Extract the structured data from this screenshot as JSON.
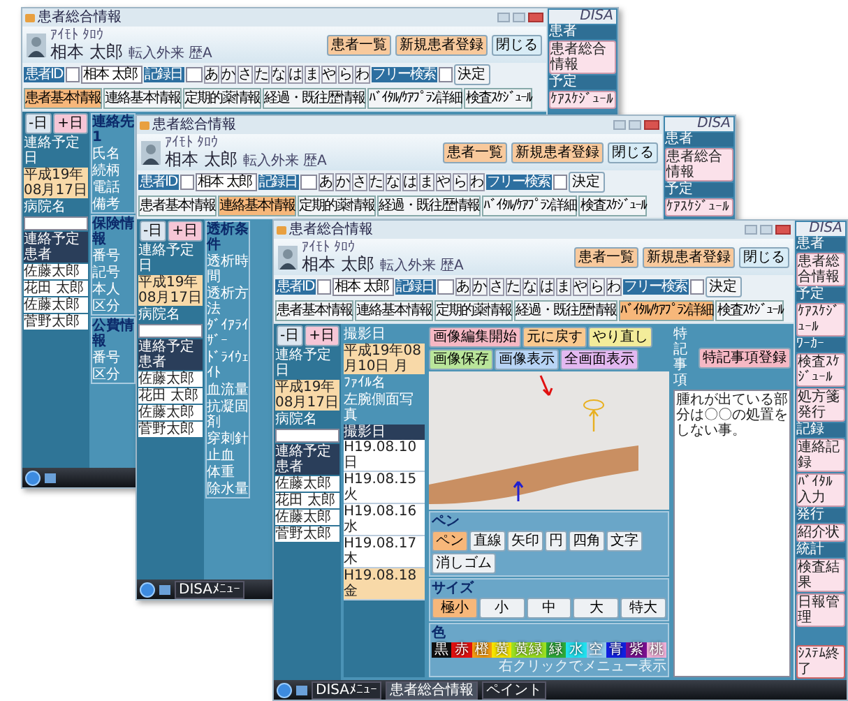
{
  "windows": [
    {
      "title": "患者総合情報",
      "patient": {
        "kana": "ｱｲﾓﾄ ﾀﾛｳ",
        "name": "相本 太郎",
        "note": "転入外来 歴A"
      },
      "buttons": [
        "患者一覧",
        "新規患者登録",
        "閉じる"
      ],
      "search": {
        "id_label": "患者ID",
        "name_value": "相本 太郎",
        "date_label": "記録日",
        "kana": [
          "あ",
          "か",
          "さ",
          "た",
          "な",
          "は",
          "ま",
          "や",
          "ら",
          "わ"
        ],
        "free_label": "フリー検索",
        "go": "決定"
      },
      "tabs": [
        {
          "label": "患者基本情報",
          "selected": true
        },
        {
          "label": "連絡基本情報",
          "selected": false
        },
        {
          "label": "定期的薬情報",
          "selected": false
        },
        {
          "label": "経過・既往歴情報",
          "selected": false
        },
        {
          "label": "ﾊﾞｲﾀﾙ/ｹｱﾌﾟﾗﾝ詳細",
          "selected": false
        },
        {
          "label": "検査ｽｹｼﾞｭｰﾙ",
          "selected": false
        }
      ],
      "left_panel": {
        "prev": "-日",
        "next": "+日",
        "date_label": "連絡予定日",
        "date": "平成19年08月17日",
        "hospital_label": "病院名",
        "list_header": "連絡予定患者",
        "patients": [
          "佐藤太郎",
          "花田 太郎",
          "佐藤太郎",
          "菅野太郎"
        ]
      },
      "body": {
        "kind": "labels",
        "groups": [
          {
            "title": "連絡先1",
            "labels": [
              "氏名",
              "続柄",
              "電話",
              "備考"
            ]
          },
          {
            "title": "保険情報",
            "labels": [
              "番号",
              "記号",
              "本人",
              "区分"
            ]
          },
          {
            "title": "公費情報",
            "labels": [
              "番号",
              "区分"
            ]
          }
        ]
      },
      "side_panel": {
        "logo": "DISA",
        "items": [
          {
            "kind": "section",
            "label": "患者"
          },
          {
            "kind": "button",
            "label": "患者総合情報"
          },
          {
            "kind": "section",
            "label": "予定"
          },
          {
            "kind": "button",
            "label": "ｹｱｽｹｼﾞｭｰﾙ"
          }
        ]
      }
    },
    {
      "title": "患者総合情報",
      "patient": {
        "kana": "ｱｲﾓﾄ ﾀﾛｳ",
        "name": "相本 太郎",
        "note": "転入外来 歴A"
      },
      "buttons": [
        "患者一覧",
        "新規患者登録",
        "閉じる"
      ],
      "search": {
        "id_label": "患者ID",
        "name_value": "相本 太郎",
        "date_label": "記録日",
        "kana": [
          "あ",
          "か",
          "さ",
          "た",
          "な",
          "は",
          "ま",
          "や",
          "ら",
          "わ"
        ],
        "free_label": "フリー検索",
        "go": "決定"
      },
      "tabs": [
        {
          "label": "患者基本情報",
          "selected": false
        },
        {
          "label": "連絡基本情報",
          "selected": true
        },
        {
          "label": "定期的薬情報",
          "selected": false
        },
        {
          "label": "経過・既往歴情報",
          "selected": false
        },
        {
          "label": "ﾊﾞｲﾀﾙ/ｹｱﾌﾟﾗﾝ詳細",
          "selected": false
        },
        {
          "label": "検査ｽｹｼﾞｭｰﾙ",
          "selected": false
        }
      ],
      "left_panel": {
        "prev": "-日",
        "next": "+日",
        "date_label": "連絡予定日",
        "date": "平成19年08月17日",
        "hospital_label": "病院名",
        "list_header": "連絡予定患者",
        "patients": [
          "佐藤太郎",
          "花田 太郎",
          "佐藤太郎",
          "菅野太郎"
        ]
      },
      "body": {
        "kind": "labels",
        "groups": [
          {
            "title": "透析条件",
            "labels": [
              "透析時間",
              "透析方法",
              "ﾀﾞｲｱﾗｲｻﾞｰ",
              "ﾄﾞﾗｲｳｪｲﾄ",
              "血流量",
              "抗凝固剤",
              "穿刺針",
              "止血",
              "体重",
              "除水量"
            ]
          }
        ]
      },
      "side_panel": {
        "logo": "DISA",
        "items": [
          {
            "kind": "section",
            "label": "患者"
          },
          {
            "kind": "button",
            "label": "患者総合情報"
          },
          {
            "kind": "section",
            "label": "予定"
          },
          {
            "kind": "button",
            "label": "ｹｱｽｹｼﾞｭｰﾙ"
          }
        ]
      },
      "taskbar": {
        "items": [
          {
            "label": "DISAﾒﾆｭｰ",
            "selected": false
          }
        ]
      }
    },
    {
      "title": "患者総合情報",
      "patient": {
        "kana": "ｱｲﾓﾄ ﾀﾛｳ",
        "name": "相本 太郎",
        "note": "転入外来 歴A"
      },
      "buttons": [
        "患者一覧",
        "新規患者登録",
        "閉じる"
      ],
      "search": {
        "id_label": "患者ID",
        "name_value": "相本 太郎",
        "date_label": "記録日",
        "kana": [
          "あ",
          "か",
          "さ",
          "た",
          "な",
          "は",
          "ま",
          "や",
          "ら",
          "わ"
        ],
        "free_label": "フリー検索",
        "go": "決定"
      },
      "tabs": [
        {
          "label": "患者基本情報",
          "selected": false
        },
        {
          "label": "連絡基本情報",
          "selected": false
        },
        {
          "label": "定期的薬情報",
          "selected": false
        },
        {
          "label": "経過・既往歴情報",
          "selected": false
        },
        {
          "label": "ﾊﾞｲﾀﾙ/ｹｱﾌﾟﾗﾝ詳細",
          "selected": true
        },
        {
          "label": "検査ｽｹｼﾞｭｰﾙ",
          "selected": false
        }
      ],
      "left_panel": {
        "prev": "-日",
        "next": "+日",
        "date_label": "連絡予定日",
        "date": "平成19年08月17日",
        "hospital_label": "病院名",
        "list_header": "連絡予定患者",
        "patients": [
          "佐藤太郎",
          "花田 太郎",
          "佐藤太郎",
          "菅野太郎"
        ]
      },
      "body": {
        "kind": "photo",
        "shot_label": "撮影日",
        "shot_date": "平成19年08月10日 月",
        "file_label": "ﾌｧｲﾙ名",
        "file_name": "左腕側面写真",
        "list_header": "撮影日",
        "dates": [
          {
            "label": "H19.08.10日",
            "selected": false
          },
          {
            "label": "H19.08.15火",
            "selected": false
          },
          {
            "label": "H19.08.16水",
            "selected": false
          },
          {
            "label": "H19.08.17木",
            "selected": false
          },
          {
            "label": "H19.08.18金",
            "selected": true
          }
        ],
        "tools": [
          {
            "label": "画像編集開始",
            "color": "#f6b8c4"
          },
          {
            "label": "元に戻す",
            "color": "#f9c98f"
          },
          {
            "label": "やり直し",
            "color": "#f3ec9a"
          },
          {
            "label": "画像保存",
            "color": "#b9e59a"
          },
          {
            "label": "画像表示",
            "color": "#b8d4f5"
          },
          {
            "label": "全画面表示",
            "color": "#e3b8f0"
          }
        ],
        "pen_label": "ペン",
        "pens": [
          {
            "label": "ペン",
            "selected": true
          },
          {
            "label": "直線",
            "selected": false
          },
          {
            "label": "矢印",
            "selected": false
          },
          {
            "label": "円",
            "selected": false
          },
          {
            "label": "四角",
            "selected": false
          },
          {
            "label": "文字",
            "selected": false
          },
          {
            "label": "消しゴム",
            "selected": false
          }
        ],
        "size_label": "サイズ",
        "sizes": [
          {
            "label": "極小",
            "selected": true
          },
          {
            "label": "小",
            "selected": false
          },
          {
            "label": "中",
            "selected": false
          },
          {
            "label": "大",
            "selected": false
          },
          {
            "label": "特大",
            "selected": false
          }
        ],
        "color_label": "色",
        "colors": [
          {
            "label": "黒",
            "color": "#111111"
          },
          {
            "label": "赤",
            "color": "#e01010"
          },
          {
            "label": "橙",
            "color": "#f39c12"
          },
          {
            "label": "黄",
            "color": "#f5e400"
          },
          {
            "label": "黄緑",
            "color": "#9be022"
          },
          {
            "label": "緑",
            "color": "#2eaa3a"
          },
          {
            "label": "水",
            "color": "#22e0ee"
          },
          {
            "label": "空",
            "color": "#8fc8ea"
          },
          {
            "label": "青",
            "color": "#1020e0"
          },
          {
            "label": "紫",
            "color": "#7a1090"
          },
          {
            "label": "桃",
            "color": "#f0b0d8"
          }
        ],
        "hint": "右クリックでメニュー表示",
        "notes_label": "特記事項",
        "notes_button": "特記事項登録",
        "notes_text": "腫れが出ている部分は〇〇の処置をしない事。"
      },
      "side_panel": {
        "logo": "DISA",
        "items": [
          {
            "kind": "section",
            "label": "患者"
          },
          {
            "kind": "button",
            "label": "患者総合情報"
          },
          {
            "kind": "section",
            "label": "予定"
          },
          {
            "kind": "button",
            "label": "ｹｱｽｹｼﾞｭｰﾙ"
          },
          {
            "kind": "section",
            "label": "ﾜｰｶｰ"
          },
          {
            "kind": "button",
            "label": "検査ｽｹｼﾞｭｰﾙ"
          },
          {
            "kind": "button",
            "label": "処方箋発行"
          },
          {
            "kind": "section",
            "label": "記録"
          },
          {
            "kind": "button",
            "label": "連絡記録"
          },
          {
            "kind": "button",
            "label": "ﾊﾞｲﾀﾙ入力"
          },
          {
            "kind": "section",
            "label": "発行"
          },
          {
            "kind": "button",
            "label": "紹介状"
          },
          {
            "kind": "section",
            "label": "統計"
          },
          {
            "kind": "button",
            "label": "検査結果"
          },
          {
            "kind": "button",
            "label": "日報管理"
          },
          {
            "kind": "exit",
            "label": "ｼｽﾃﾑ終了"
          }
        ]
      },
      "taskbar": {
        "items": [
          {
            "label": "DISAﾒﾆｭｰ",
            "selected": false
          },
          {
            "label": "患者総合情報",
            "selected": true
          },
          {
            "label": "ペイント",
            "selected": false
          }
        ]
      }
    }
  ]
}
